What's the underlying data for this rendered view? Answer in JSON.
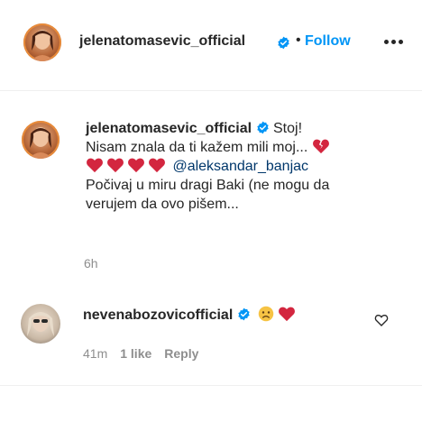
{
  "header": {
    "username": "jelenatomasevic_official",
    "separator": "•",
    "follow_label": "Follow"
  },
  "caption": {
    "username": "jelenatomasevic_official",
    "text_part1": "Stoj!",
    "text_part2": "Nisam znala da ti kažem mili moj...",
    "mention": "@aleksandar_banjac",
    "text_part3": "Počivaj u miru dragi Baki (ne mogu da",
    "text_part4": "verujem da ovo pišem...",
    "time": "6h"
  },
  "comment": {
    "username": "nevenabozovicofficial",
    "emojis": [
      "sad-face",
      "red-heart"
    ],
    "time": "41m",
    "likes": "1 like",
    "reply_label": "Reply"
  },
  "colors": {
    "link_blue": "#0095f6",
    "mention_blue": "#00376b",
    "muted": "#8e8e8e",
    "heart_red": "#d3263f"
  }
}
